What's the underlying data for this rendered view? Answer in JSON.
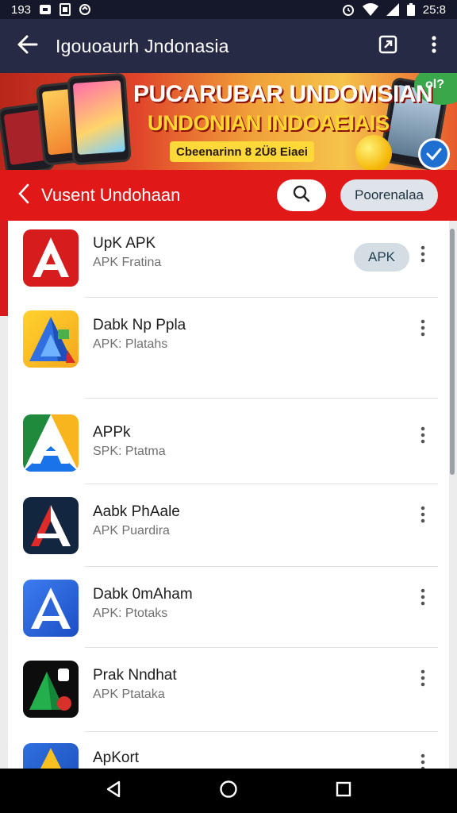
{
  "status_bar": {
    "left_text": "193",
    "time": "25:8",
    "icons": [
      "notification-icon",
      "image-icon",
      "sync-icon",
      "alarm-icon",
      "wifi-icon",
      "signal-icon",
      "battery-icon"
    ]
  },
  "app_bar": {
    "title": "Igouoaurh Jndonasia",
    "icons": [
      "back-arrow-icon",
      "open-external-icon",
      "overflow-menu-icon"
    ]
  },
  "banner": {
    "headline_1": "PUCARUBAR UNDOMSIAN",
    "headline_2": "UNDONIAN INDOAEIAIS",
    "subline": "Cbeenarinn 8 2Ü8 Eiaei",
    "corner_text": "ol?",
    "colors": {
      "primary": "#e0442a",
      "accent": "#ffd62e"
    }
  },
  "sub_bar": {
    "title": "Vusent Undohaan",
    "chip_label": "Poorenalaa",
    "accent": "#e11818"
  },
  "apps": [
    {
      "name": "UpK APK",
      "subtitle": "APK Fratina",
      "button": "APK",
      "icon": "apk-red-icon"
    },
    {
      "name": "Dabk Np Ppla",
      "subtitle": "APK: Platahs",
      "icon": "apk-gradient-icon"
    },
    {
      "name": "APPk",
      "subtitle": "SPK: Ptatma",
      "icon": "apk-tricolor-icon"
    },
    {
      "name": "Aabk PhAale",
      "subtitle": "APK Puardira",
      "icon": "apk-navy-icon"
    },
    {
      "name": "Dabk 0mAham",
      "subtitle": "APK: Ptotaks",
      "icon": "apk-blue-icon"
    },
    {
      "name": "Prak Nndhat",
      "subtitle": "APK Ptataka",
      "icon": "apk-black-icon"
    },
    {
      "name": "ApKort",
      "subtitle": "",
      "icon": "apk-partial-icon"
    }
  ],
  "nav_bar": {
    "icons": [
      "nav-back-icon",
      "nav-home-icon",
      "nav-recents-icon"
    ]
  }
}
